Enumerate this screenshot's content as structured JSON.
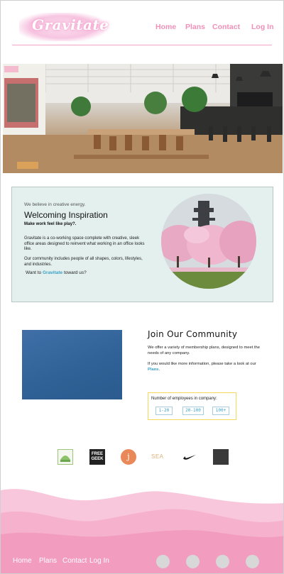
{
  "header": {
    "logo_text": "Gravitate",
    "nav": [
      {
        "label": "Home"
      },
      {
        "label": "Plans"
      },
      {
        "label": "Contact"
      },
      {
        "label": "Log In"
      }
    ]
  },
  "welcome": {
    "tagline": "We believe in creative energy.",
    "title": "Welcoming Inspiration",
    "subtitle": "Make work feel like play?.",
    "paragraph1": "Gravitate is a co-working space complete with creative, sleek office areas designed to reinvent what working in an office looks like.",
    "paragraph2": "Our community includes people of all shapes, colors, lifestyles, and industries.",
    "want_prefix": "Want to",
    "want_link": "Gravitate",
    "want_suffix": "toward us?"
  },
  "community": {
    "title": "Join Our Community",
    "paragraph1": "We offer a variety of membership plans, designed to meet the needs of any company.",
    "paragraph2_prefix": "If you would like more information, please take a look at our",
    "paragraph2_link": "Plans",
    "paragraph2_suffix": ".",
    "employees_label": "Number of employees in company:",
    "employee_options": [
      "1-20",
      "20-100",
      "100+"
    ]
  },
  "partner_logos": [
    {
      "icon": "green-leaf-logo",
      "text": ""
    },
    {
      "icon": "free-geek-logo",
      "text": "FREE GEEK"
    },
    {
      "icon": "orange-j-logo",
      "text": "j"
    },
    {
      "icon": "sea-logo",
      "text": "SEA"
    },
    {
      "icon": "nike-swoosh-logo",
      "text": ""
    },
    {
      "icon": "dark-square-logo",
      "text": ""
    }
  ],
  "footer": {
    "links": [
      {
        "label": "Home"
      },
      {
        "label": "Plans"
      },
      {
        "label": "Contact"
      },
      {
        "label": "Log In"
      }
    ],
    "social_icons": [
      "social-icon-1",
      "social-icon-2",
      "social-icon-3",
      "social-icon-4"
    ]
  },
  "colors": {
    "accent_pink": "#f090b8",
    "link_blue": "#3aa0c8",
    "welcome_bg": "#e4f0ee",
    "wave_pink": "#f49ac0"
  }
}
